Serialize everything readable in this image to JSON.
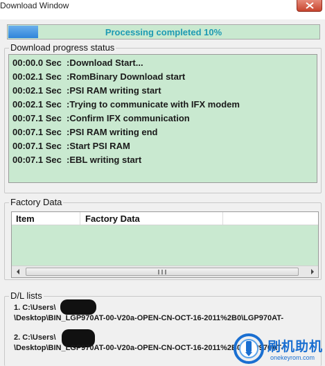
{
  "window": {
    "title": "Download Window"
  },
  "progress": {
    "label": "Processing completed 10%",
    "percent": 10,
    "fill_color": "#2f84da",
    "track_color": "#c9e9d0"
  },
  "status_group": {
    "title": "Download progress status",
    "lines": [
      "00:00.0 Sec  :Download Start...",
      "00:02.1 Sec  :RomBinary Download start",
      "00:02.1 Sec  :PSI RAM writing start",
      "00:02.1 Sec  :Trying to communicate with IFX modem",
      "00:07.1 Sec  :Confirm IFX communication",
      "00:07.1 Sec  :PSI RAM writing end",
      "00:07.1 Sec  :Start PSI RAM",
      "00:07.1 Sec  :EBL writing start"
    ]
  },
  "factory_group": {
    "title": "Factory Data",
    "columns": [
      "Item",
      "Factory Data"
    ]
  },
  "dl_group": {
    "title": "D/L lists",
    "items": [
      {
        "line1": "1. C:\\Users\\",
        "line2": "\\Desktop\\BIN_LGP970AT-00-V20a-OPEN-CN-OCT-16-2011%2B0\\LGP970AT-"
      },
      {
        "line1": "2. C:\\Users\\",
        "line2": "\\Desktop\\BIN_LGP970AT-00-V20a-OPEN-CN-OCT-16-2011%2B0\\LGP970AT-"
      }
    ]
  },
  "watermark": {
    "brand_cn": "刷机助机",
    "brand_en": "onekeyrom.com",
    "color": "#1a6fd1"
  }
}
